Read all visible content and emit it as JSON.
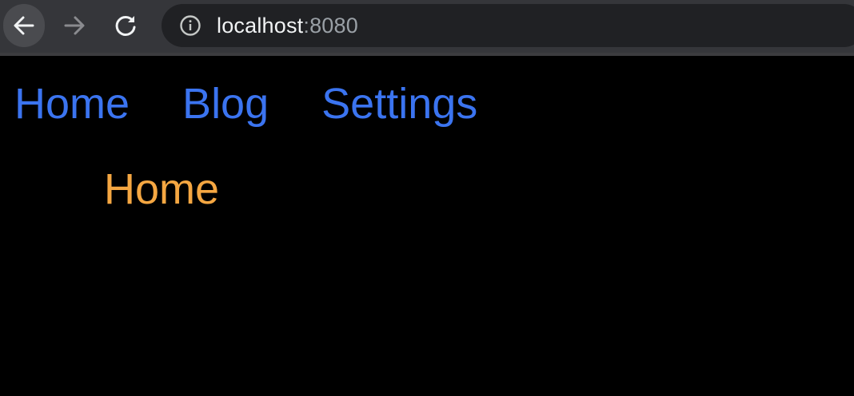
{
  "browser": {
    "back_icon": "arrow-left-icon",
    "forward_icon": "arrow-right-icon",
    "reload_icon": "reload-icon",
    "site_info_icon": "info-icon",
    "url_host": "localhost",
    "url_port": ":8080"
  },
  "nav": {
    "links": [
      {
        "label": "Home"
      },
      {
        "label": "Blog"
      },
      {
        "label": "Settings"
      }
    ],
    "link_color": "#3b74f0"
  },
  "content": {
    "current_page": "Home",
    "current_page_color": "#f5a742"
  }
}
